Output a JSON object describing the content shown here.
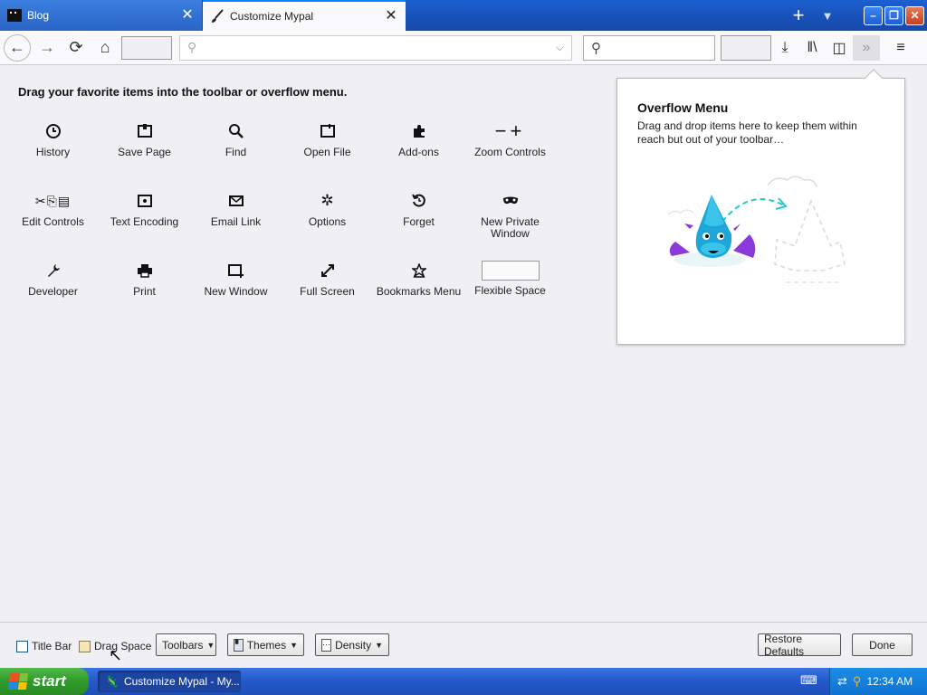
{
  "tabs": [
    {
      "title": "Blog",
      "icon": "blog-favicon",
      "active": false
    },
    {
      "title": "Customize Mypal",
      "icon": "brush-icon",
      "active": true
    }
  ],
  "window_controls": {
    "minimize": "–",
    "restore": "❐",
    "close": "✕"
  },
  "navbar": {
    "url_placeholder": "",
    "search_placeholder": ""
  },
  "main": {
    "heading": "Drag your favorite items into the toolbar or overflow menu.",
    "palette": [
      {
        "label": "History",
        "icon": "history-icon",
        "glyph": "◷"
      },
      {
        "label": "Save Page",
        "icon": "save-page-icon",
        "glyph": "🗋"
      },
      {
        "label": "Find",
        "icon": "find-icon",
        "glyph": "🔍"
      },
      {
        "label": "Open File",
        "icon": "open-file-icon",
        "glyph": "🗁"
      },
      {
        "label": "Add-ons",
        "icon": "addons-icon",
        "glyph": "✤"
      },
      {
        "label": "Zoom Controls",
        "icon": "zoom-controls-icon",
        "glyph": "− +"
      },
      {
        "label": "Edit Controls",
        "icon": "edit-controls-icon",
        "glyph": "✂⎘📋"
      },
      {
        "label": "Text Encoding",
        "icon": "text-encoding-icon",
        "glyph": "▣"
      },
      {
        "label": "Email Link",
        "icon": "email-link-icon",
        "glyph": "✉"
      },
      {
        "label": "Options",
        "icon": "options-icon",
        "glyph": "✲"
      },
      {
        "label": "Forget",
        "icon": "forget-icon",
        "glyph": "↺"
      },
      {
        "label": "New Private Window",
        "icon": "private-window-icon",
        "glyph": "∞"
      },
      {
        "label": "Developer",
        "icon": "developer-icon",
        "glyph": "🔧"
      },
      {
        "label": "Print",
        "icon": "print-icon",
        "glyph": "🖶"
      },
      {
        "label": "New Window",
        "icon": "new-window-icon",
        "glyph": "⊞"
      },
      {
        "label": "Full Screen",
        "icon": "full-screen-icon",
        "glyph": "⤢"
      },
      {
        "label": "Bookmarks Menu",
        "icon": "bookmarks-menu-icon",
        "glyph": "☆"
      },
      {
        "label": "Flexible Space",
        "icon": "flexible-space-box",
        "glyph": ""
      }
    ]
  },
  "overflow_panel": {
    "title": "Overflow Menu",
    "description": "Drag and drop items here to keep them within reach but out of your toolbar…"
  },
  "footer": {
    "title_bar": "Title Bar",
    "drag_space": "Drag Space",
    "toolbars": "Toolbars",
    "themes": "Themes",
    "density": "Density",
    "restore_defaults": "Restore Defaults",
    "done": "Done"
  },
  "taskbar": {
    "start": "start",
    "task_label": "Customize Mypal - My...",
    "clock": "12:34 AM"
  },
  "colors": {
    "accent": "#0a84ff",
    "tabbar": "#1c5fd0",
    "start_green": "#2f9a2a"
  }
}
